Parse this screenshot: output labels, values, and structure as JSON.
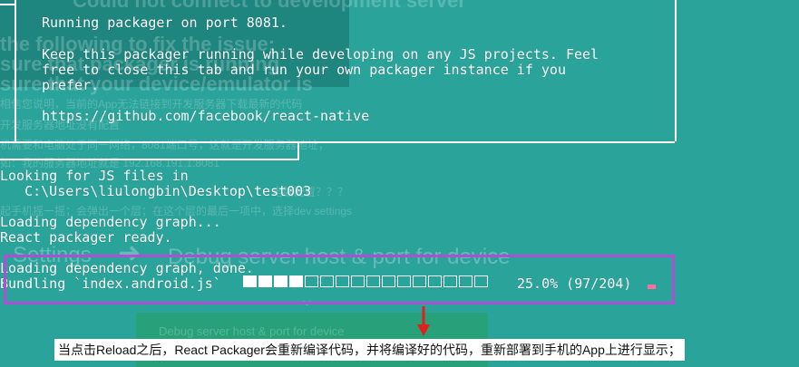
{
  "background": {
    "title_partial": "Could not connect to development server",
    "line1": "the following to fix the issue:",
    "line2": "sure that packager is running",
    "line3": "sure that your device/emulator is",
    "cn1": "相信您说明，当前的App无法链接到开发服务器下载最新的代码",
    "cn2": "开发服务器地址没有配置",
    "cn3": "机需要和电脑处于同一网络，8081端口号，这就是开发服务器地址；",
    "cn4": "如：我的服务器地址就是 192.168.191.1:8081",
    "cn5": "电脑配置？？？",
    "cn6": "起手机摇一摇；会弹出一个层；在这个层的最后一项中，选择dev settings",
    "settings": "Settings",
    "debug_host": "Debug server host & port for device",
    "debug_button": "Debug server host & port for device"
  },
  "terminal": {
    "box_line1": "Running packager on port 8081.",
    "box_line2": "Keep this packager running while developing on any JS projects. Feel",
    "box_line3": "free to close this tab and run your own packager instance if you",
    "box_line4": "prefer.",
    "box_line5": "https://github.com/facebook/react-native",
    "looking": "Looking for JS files in",
    "path": "   C:\\Users\\liulongbin\\Desktop\\test003",
    "loading1": "Loading dependency graph...",
    "ready": "React packager ready.",
    "loading2": "Loading dependency graph, done.",
    "bundling": "Bundling `index.android.js`",
    "percent": "25.0% (97/204)"
  },
  "progress": {
    "filled": 4,
    "total": 16,
    "fraction": 0.25
  },
  "caption": "当点击Reload之后，React Packager会重新编译代码，并将编译好的代码，重新部署到手机的App上进行显示；",
  "colors": {
    "background": "#2aa39a",
    "highlight": "#b04ed6",
    "arrow": "#e0201c",
    "cursor": "#ff6f9a"
  }
}
